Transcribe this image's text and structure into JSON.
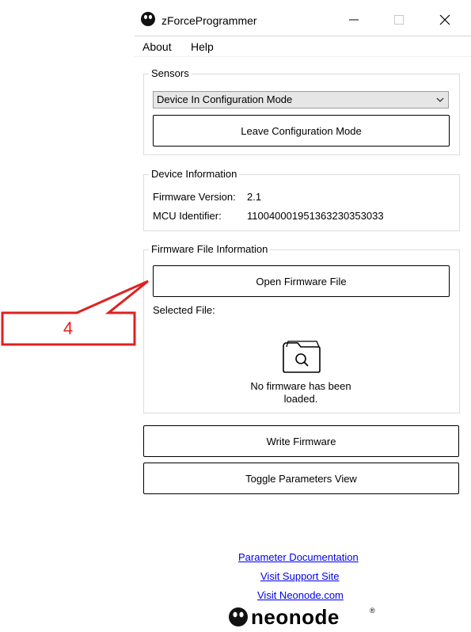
{
  "window": {
    "title": "zForceProgrammer"
  },
  "menu": {
    "items": [
      "About",
      "Help"
    ]
  },
  "sensors": {
    "group_label": "Sensors",
    "selected": "Device In Configuration Mode",
    "leave_button": "Leave Configuration Mode"
  },
  "device_info": {
    "group_label": "Device Information",
    "firmware_label": "Firmware Version:",
    "firmware_value": "2.1",
    "mcu_label": "MCU Identifier:",
    "mcu_value": "110040001951363230353033"
  },
  "firmware_file": {
    "group_label": "Firmware File Information",
    "open_button": "Open Firmware File",
    "selected_label": "Selected File:",
    "empty_message_line1": "No firmware has been",
    "empty_message_line2": "loaded."
  },
  "actions": {
    "write_button": "Write Firmware",
    "toggle_button": "Toggle Parameters View"
  },
  "links": [
    "Parameter Documentation",
    "Visit Support Site",
    "Visit Neonode.com"
  ],
  "logo_text": "neonode",
  "annotation": {
    "label": "4",
    "color": "#e02020"
  }
}
